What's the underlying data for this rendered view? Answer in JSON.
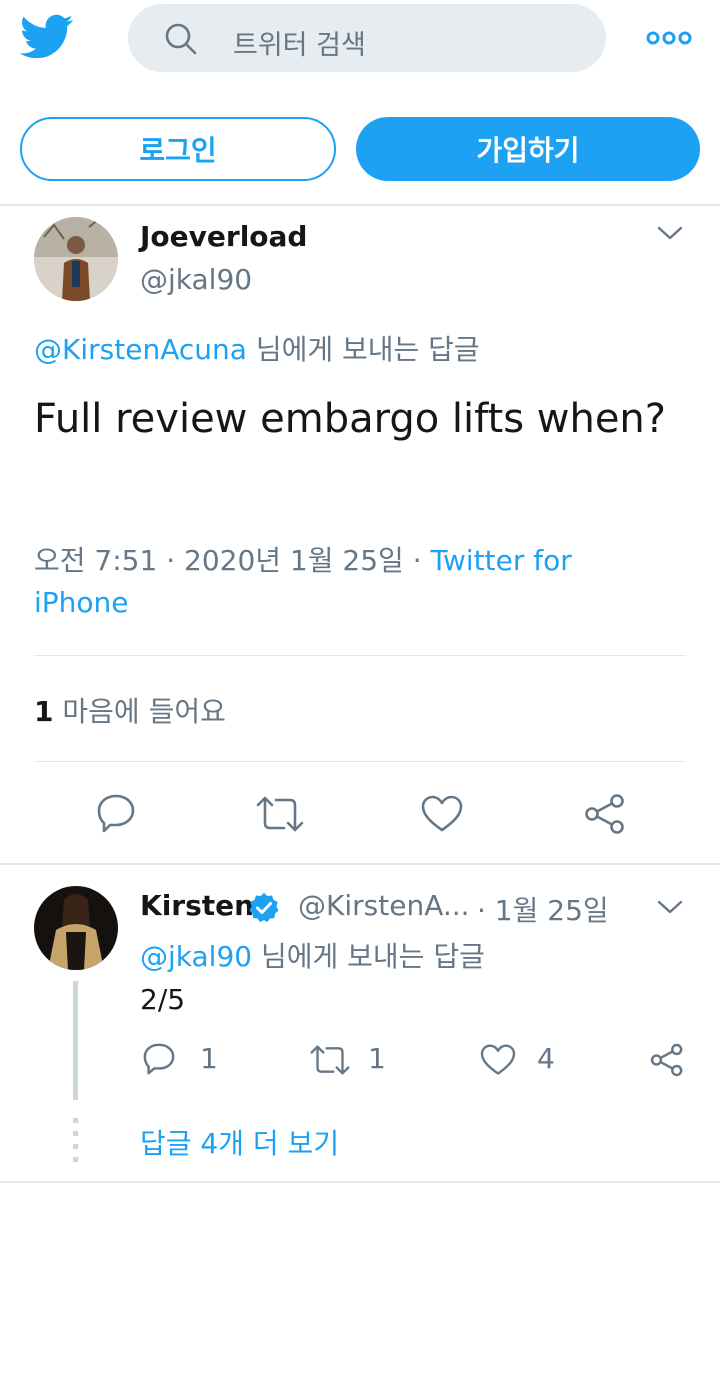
{
  "header": {
    "search_placeholder": "트위터 검색",
    "login_label": "로그인",
    "signup_label": "가입하기"
  },
  "tweet": {
    "author_name": "Joeverload",
    "author_handle": "@jkal90",
    "reply_mention": "@KirstenAcuna",
    "reply_suffix": "님에게 보내는 답글",
    "text": "Full review embargo lifts when?",
    "time": "오전 7:51 · 2020년 1월 25일",
    "source_sep": "·",
    "source": "Twitter for iPhone",
    "likes_count": "1",
    "likes_label": "마음에 들어요"
  },
  "reply": {
    "author_name": "Kirsten",
    "author_handle": "@KirstenA...",
    "date": "· 1월 25일",
    "reply_mention": "@jkal90",
    "reply_suffix": "님에게 보내는 답글",
    "text": "2/5",
    "reply_count": "1",
    "retweet_count": "1",
    "like_count": "4",
    "more_replies": "답글 4개 더 보기"
  },
  "colors": {
    "accent": "#1da1f2",
    "muted": "#657786",
    "divider": "#e1e8ed"
  }
}
